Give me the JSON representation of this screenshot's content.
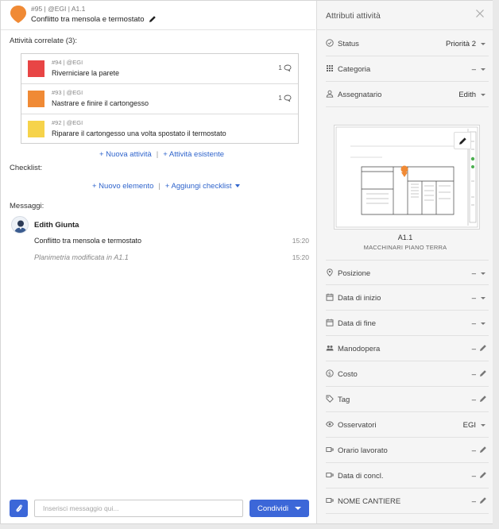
{
  "header": {
    "meta": "#95 | @EGI | A1.1",
    "title": "Conflitto tra mensola e termostato"
  },
  "related": {
    "label": "Attività correlate (3):",
    "items": [
      {
        "meta": "#94 | @EGI",
        "title": "Riverniciare la parete",
        "count": "1",
        "color": "#e84545"
      },
      {
        "meta": "#93 | @EGI",
        "title": "Nastrare e finire il cartongesso",
        "count": "1",
        "color": "#f08a35"
      },
      {
        "meta": "#92 | @EGI",
        "title": "Riparare il cartongesso una volta spostato il termostato",
        "count": "",
        "color": "#f6d34a"
      }
    ],
    "add_new": "+ Nuova attività",
    "add_existing": "+ Attività esistente"
  },
  "checklist": {
    "label": "Checklist:",
    "add_item": "+ Nuovo elemento",
    "add_checklist": "+ Aggiungi checklist"
  },
  "messages": {
    "label": "Messaggi:",
    "author": "Edith Giunta",
    "items": [
      {
        "text": "Conflitto tra mensola e termostato",
        "time": "15:20"
      },
      {
        "text": "Planimetria modificata in A1.1",
        "time": "15:20"
      }
    ]
  },
  "composer": {
    "placeholder": "Inserisci messaggio qui...",
    "share_label": "Condividi"
  },
  "panel": {
    "title": "Attributi attività",
    "attributes_top": [
      {
        "label": "Status",
        "value": "Priorità 2",
        "icon": "status-icon",
        "action": "dropdown"
      },
      {
        "label": "Categoria",
        "value": "–",
        "icon": "category-icon",
        "action": "dropdown"
      },
      {
        "label": "Assegnatario",
        "value": "Edith",
        "icon": "user-icon",
        "action": "dropdown"
      }
    ],
    "plan": {
      "code": "A1.1",
      "name": "MACCHINARI PIANO TERRA"
    },
    "attributes_bottom": [
      {
        "label": "Posizione",
        "value": "–",
        "icon": "location-icon",
        "action": "dropdown"
      },
      {
        "label": "Data di inizio",
        "value": "–",
        "icon": "calendar-icon",
        "action": "dropdown"
      },
      {
        "label": "Data di fine",
        "value": "–",
        "icon": "calendar-icon",
        "action": "dropdown"
      },
      {
        "label": "Manodopera",
        "value": "–",
        "icon": "people-icon",
        "action": "edit"
      },
      {
        "label": "Costo",
        "value": "–",
        "icon": "dollar-icon",
        "action": "edit"
      },
      {
        "label": "Tag",
        "value": "–",
        "icon": "tag-icon",
        "action": "edit"
      },
      {
        "label": "Osservatori",
        "value": "EGI",
        "icon": "eye-icon",
        "action": "dropdown"
      },
      {
        "label": "Orario lavorato",
        "value": "–",
        "icon": "custom-field-icon",
        "action": "edit"
      },
      {
        "label": "Data di concl.",
        "value": "–",
        "icon": "custom-field-icon",
        "action": "edit"
      },
      {
        "label": "NOME CANTIERE",
        "value": "–",
        "icon": "custom-field-icon",
        "action": "edit"
      }
    ]
  },
  "colors": {
    "accent": "#3c67d8",
    "link": "#2f64cc",
    "pin": "#f08a35"
  }
}
